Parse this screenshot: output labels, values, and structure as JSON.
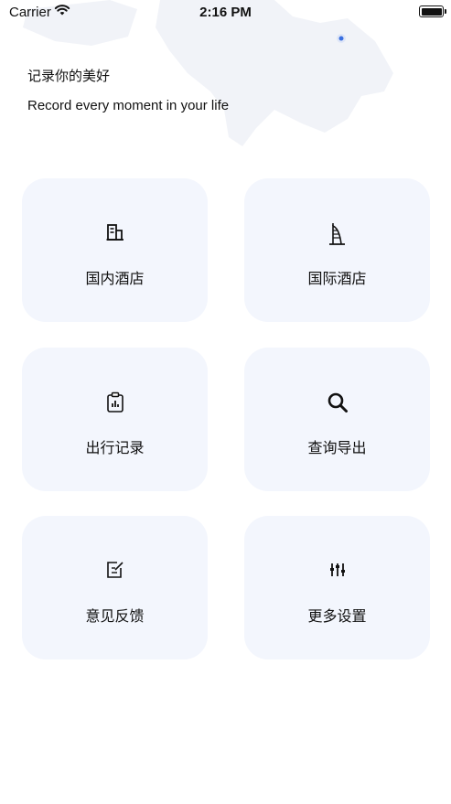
{
  "status": {
    "carrier": "Carrier",
    "time": "2:16 PM"
  },
  "header": {
    "slogan_cn": "记录你的美好",
    "slogan_en": "Record every moment in your life"
  },
  "menu": [
    {
      "label": "国内酒店",
      "icon": "building-icon"
    },
    {
      "label": "国际酒店",
      "icon": "tower-hotel-icon"
    },
    {
      "label": "出行记录",
      "icon": "clipboard-chart-icon"
    },
    {
      "label": "查询导出",
      "icon": "search-icon"
    },
    {
      "label": "意见反馈",
      "icon": "edit-note-icon"
    },
    {
      "label": "更多设置",
      "icon": "sliders-icon"
    }
  ],
  "colors": {
    "card_bg": "#f3f6fd",
    "text": "#111111",
    "map": "#eef1f8"
  }
}
